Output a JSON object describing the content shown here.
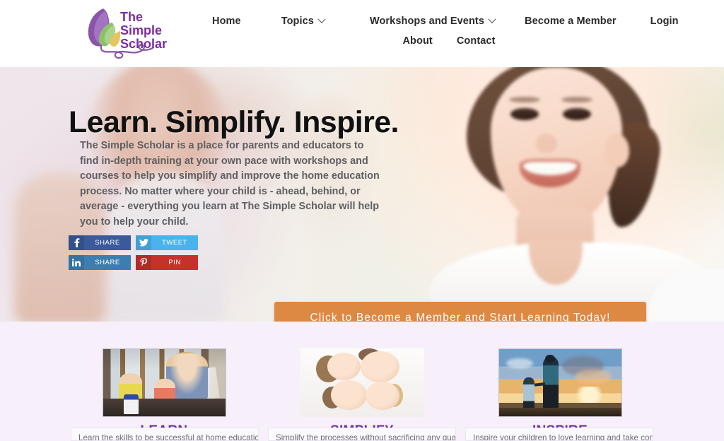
{
  "site": {
    "logo_line1": "The",
    "logo_line2": "Simple",
    "logo_line3": "Scholar",
    "logo_alt": "The Simple Scholar"
  },
  "nav": {
    "items": [
      {
        "label": "Home",
        "has_dropdown": false
      },
      {
        "label": "Topics",
        "has_dropdown": true
      },
      {
        "label": "Workshops and Events",
        "has_dropdown": true
      },
      {
        "label": "Become a Member",
        "has_dropdown": false
      },
      {
        "label": "Login",
        "has_dropdown": false
      },
      {
        "label": "About",
        "has_dropdown": false
      },
      {
        "label": "Contact",
        "has_dropdown": false
      }
    ]
  },
  "hero": {
    "title": "Learn. Simplify. Inspire.",
    "paragraph": "The Simple Scholar is a place for parents and educators to find in-depth training at your own pace with workshops and courses to help you simplify and improve the home education process.  No matter where your child is - ahead, behind, or average - everything you learn at The Simple Scholar will help you to help your child.",
    "cta_label": "Click to Become a Member and Start Learning Today!",
    "cta_color": "#dd8843",
    "share": [
      {
        "network": "facebook",
        "label": "SHARE",
        "icon": "facebook-icon",
        "color": "#3a5a9b"
      },
      {
        "network": "twitter",
        "label": "TWEET",
        "icon": "twitter-icon",
        "color": "#4ab3ee"
      },
      {
        "network": "linkedin",
        "label": "SHARE",
        "icon": "linkedin-icon",
        "color": "#3d7eb1"
      },
      {
        "network": "pinterest",
        "label": "PIN",
        "icon": "pinterest-icon",
        "color": "#c5322c"
      }
    ]
  },
  "features": {
    "background": "#f7f0fb",
    "title_color": "#6b2fa0",
    "cards": [
      {
        "title": "LEARN",
        "image_alt": "mother homeschooling two young children at a cluttered desk",
        "description": "Learn the skills to be successful at home education!"
      },
      {
        "title": "SIMPLIFY",
        "image_alt": "family of four lying down together heads close",
        "description": "Simplify the processes without sacrificing any quality or"
      },
      {
        "title": "INSPIRE",
        "image_alt": "silhouette of father and daughter holding hands at sunset",
        "description": "Inspire your children to love learning and take control of"
      }
    ]
  }
}
